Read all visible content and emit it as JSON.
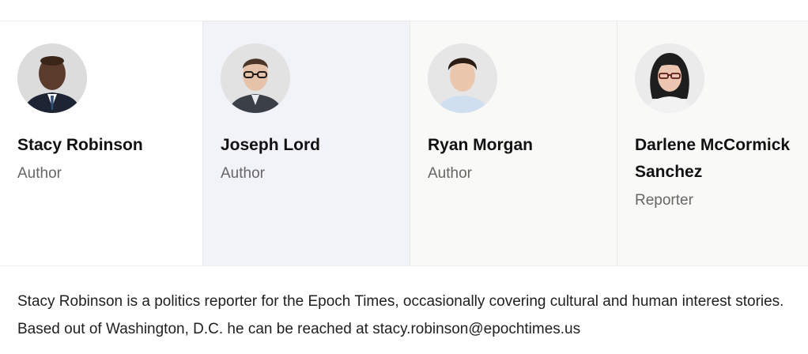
{
  "authors": [
    {
      "name": "Stacy Robinson",
      "role": "Author",
      "avatar_icon": "author-photo"
    },
    {
      "name": "Joseph Lord",
      "role": "Author",
      "avatar_icon": "author-photo"
    },
    {
      "name": "Ryan Morgan",
      "role": "Author",
      "avatar_icon": "author-photo"
    },
    {
      "name": "Darlene McCormick Sanchez",
      "role": "Reporter",
      "avatar_icon": "author-photo"
    }
  ],
  "bio": {
    "text": "Stacy Robinson is a politics reporter for the Epoch Times, occasionally covering cultural and human interest stories. Based out of Washington, D.C. he can be reached at stacy.robinson@epochtimes.us"
  },
  "colors": {
    "selected_card_bg": "#ffffff",
    "card_bg_alt": "#f2f3f8",
    "card_bg": "#f9f9f7",
    "name_color": "#111111",
    "role_color": "#666666"
  }
}
